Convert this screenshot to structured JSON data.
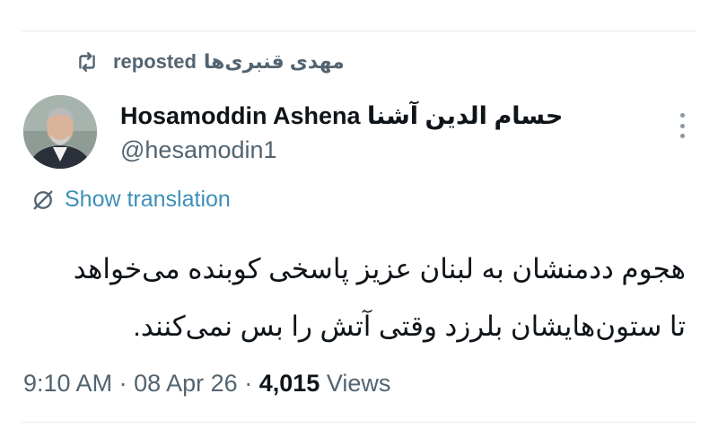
{
  "repost": {
    "user": "مهدی قنبری‌ها",
    "label": "reposted",
    "icon": "repost-icon"
  },
  "author": {
    "display_name": "Hosamoddin Ashena حسام الدين آشنا",
    "handle": "@hesamodin1",
    "avatar_icon": "avatar"
  },
  "translation": {
    "label": "Show translation",
    "icon": "translate-icon"
  },
  "tweet": {
    "line1": "هجوم  ددمنشان به لبنان عزیز پاسخی کوبنده می‌خواهد",
    "line2": "تا ستون‌هایشان بلرزد وقتی  آتش را بس نمی‌کنند."
  },
  "meta": {
    "time": "9:10 AM",
    "separator1": "·",
    "date": "08 Apr 26",
    "separator2": "·",
    "views_count": "4,015",
    "views_label": "Views"
  },
  "colors": {
    "text": "#0f1419",
    "secondary": "#536471",
    "link": "#3d8fb8",
    "divider": "#e6ecf0"
  }
}
